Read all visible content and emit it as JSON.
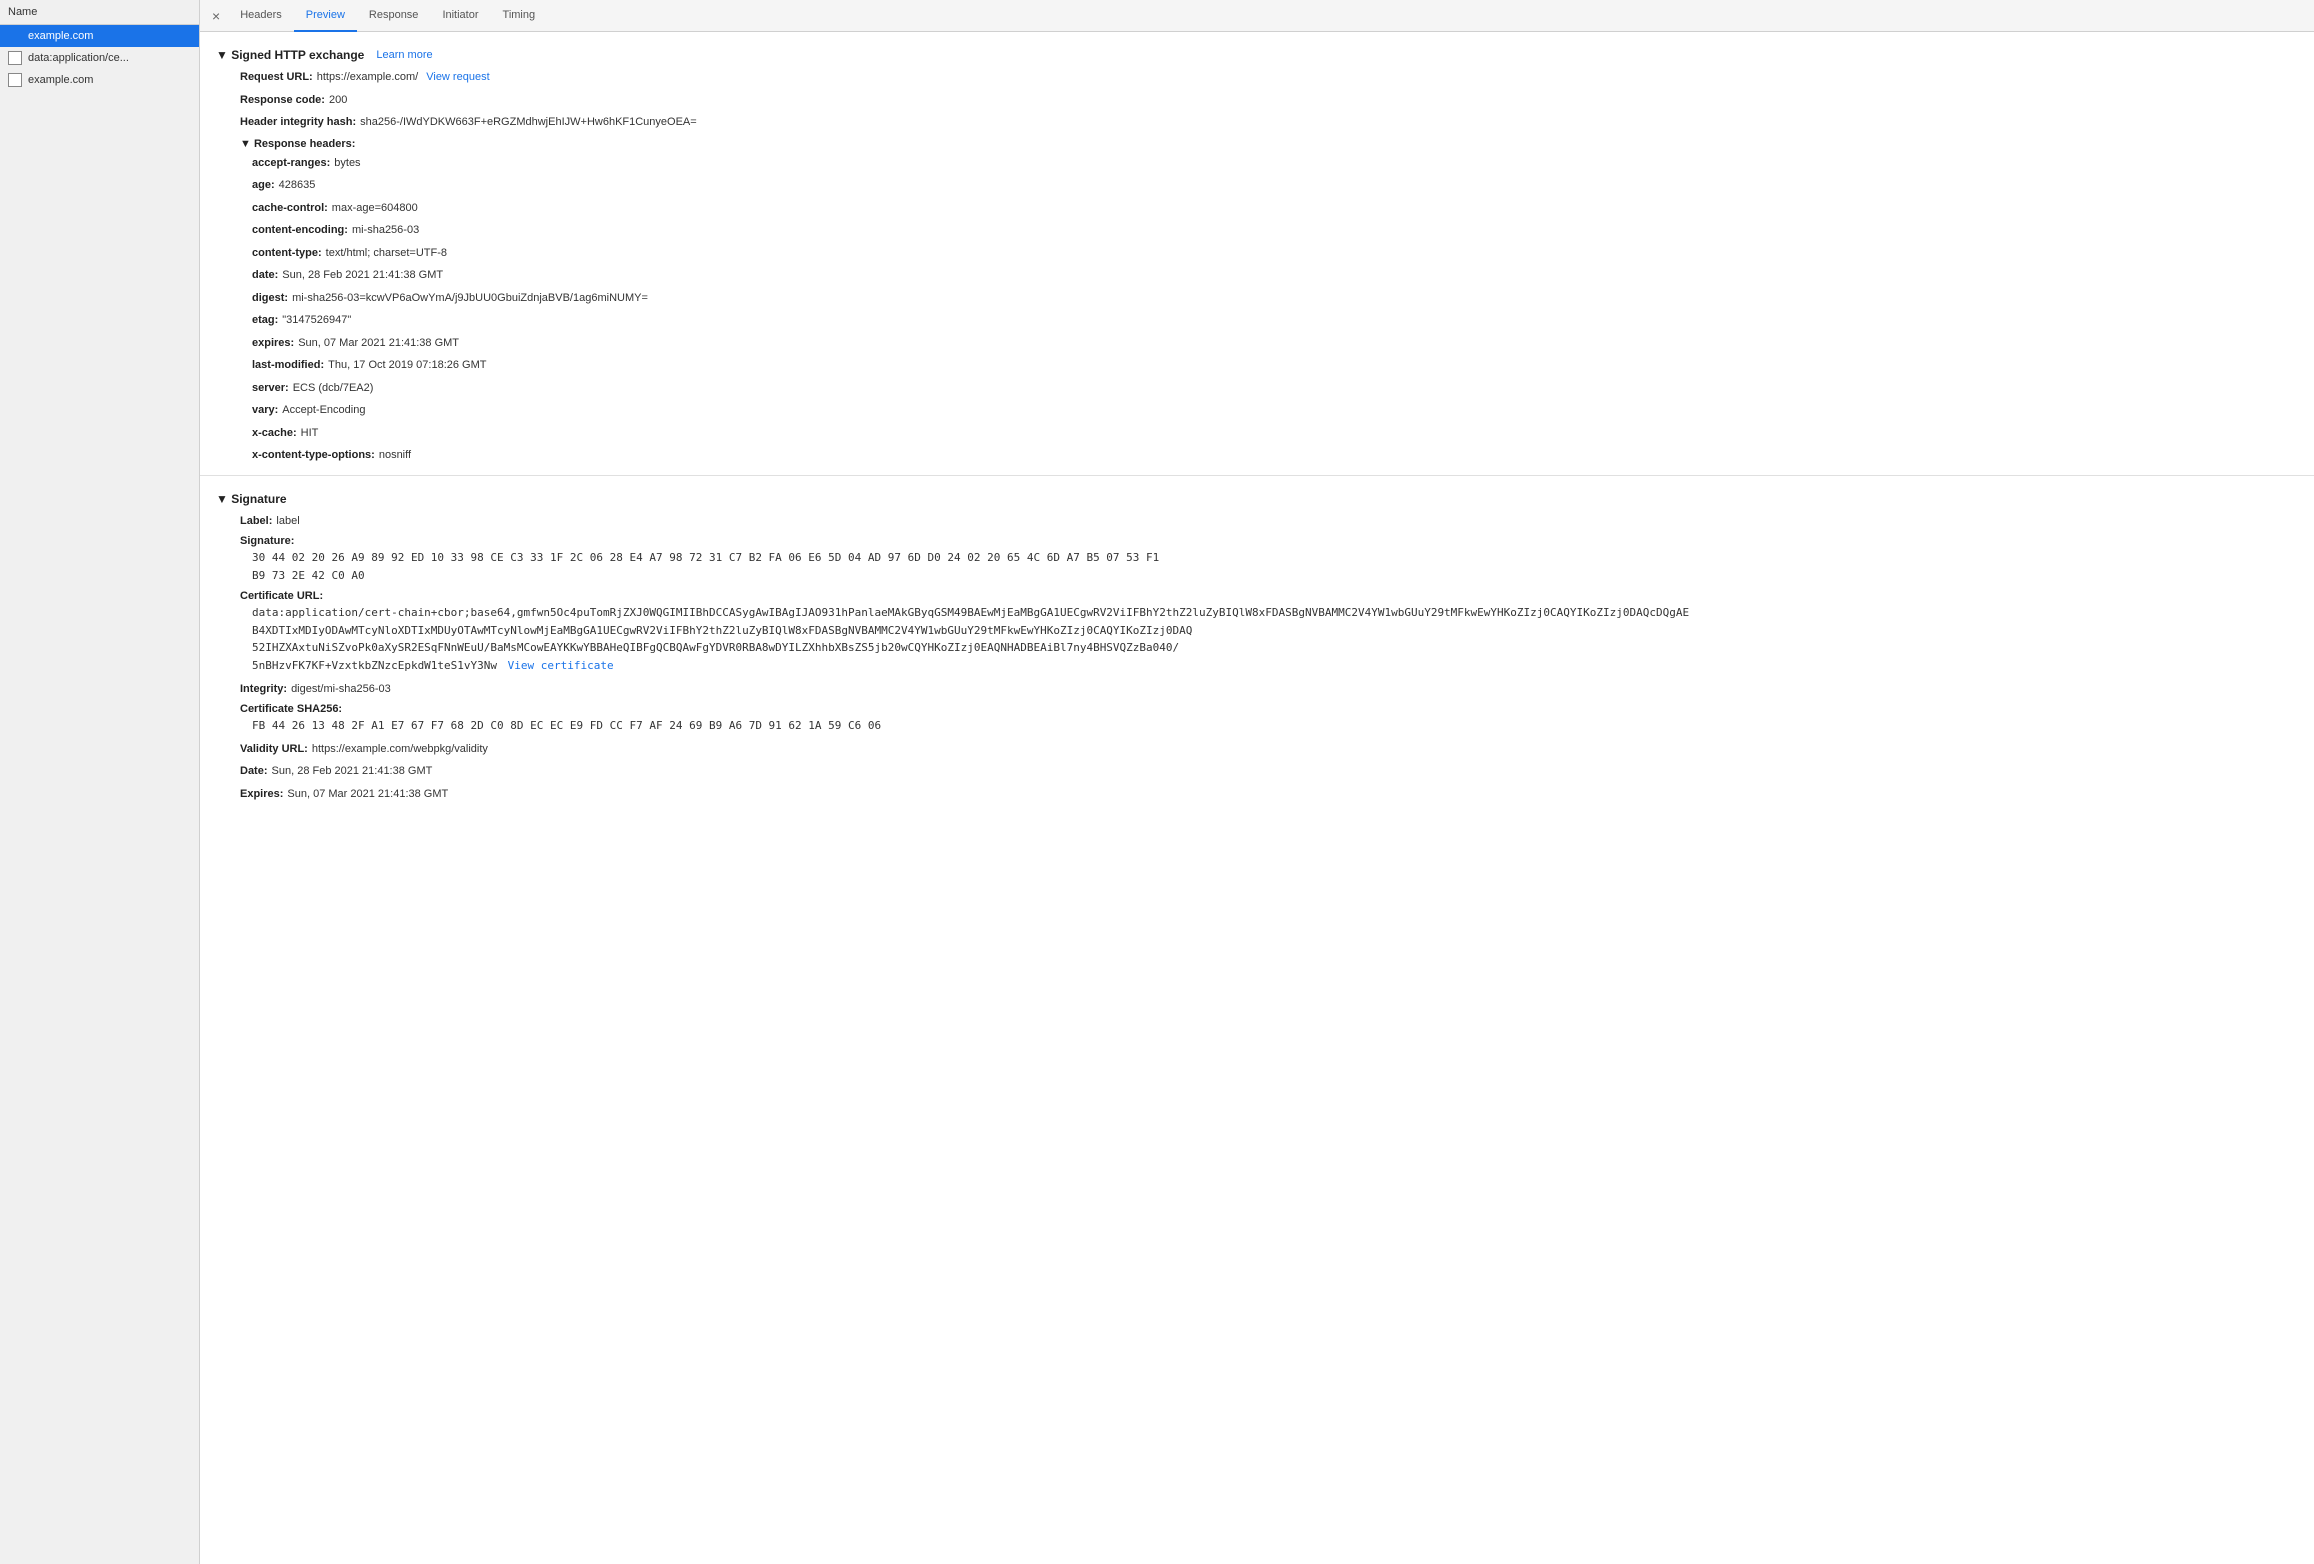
{
  "sidebar": {
    "header": "Name",
    "items": [
      {
        "id": "item-example-com",
        "label": "example.com",
        "active": true
      },
      {
        "id": "item-data-app",
        "label": "data:application/ce...",
        "active": false
      },
      {
        "id": "item-example-com-2",
        "label": "example.com",
        "active": false
      }
    ]
  },
  "tabs": {
    "close_label": "×",
    "items": [
      {
        "id": "tab-headers",
        "label": "Headers",
        "active": false
      },
      {
        "id": "tab-preview",
        "label": "Preview",
        "active": true
      },
      {
        "id": "tab-response",
        "label": "Response",
        "active": false
      },
      {
        "id": "tab-initiator",
        "label": "Initiator",
        "active": false
      },
      {
        "id": "tab-timing",
        "label": "Timing",
        "active": false
      }
    ]
  },
  "signed_http": {
    "section_title": "▼ Signed HTTP exchange",
    "learn_more": "Learn more",
    "request_url_label": "Request URL:",
    "request_url_value": "https://example.com/",
    "view_request": "View request",
    "response_code_label": "Response code:",
    "response_code_value": "200",
    "header_integrity_label": "Header integrity hash:",
    "header_integrity_value": "sha256-/IWdYDKW663F+eRGZMdhwjEhIJW+Hw6hKF1CunyeOEA=",
    "response_headers_title": "▼ Response headers:",
    "headers": [
      {
        "label": "accept-ranges:",
        "value": "bytes"
      },
      {
        "label": "age:",
        "value": "428635"
      },
      {
        "label": "cache-control:",
        "value": "max-age=604800"
      },
      {
        "label": "content-encoding:",
        "value": "mi-sha256-03"
      },
      {
        "label": "content-type:",
        "value": "text/html; charset=UTF-8"
      },
      {
        "label": "date:",
        "value": "Sun, 28 Feb 2021 21:41:38 GMT"
      },
      {
        "label": "digest:",
        "value": "mi-sha256-03=kcwVP6aOwYmA/j9JbUU0GbuiZdnjaBVB/1ag6miNUMY="
      },
      {
        "label": "etag:",
        "value": "\"3147526947\""
      },
      {
        "label": "expires:",
        "value": "Sun, 07 Mar 2021 21:41:38 GMT"
      },
      {
        "label": "last-modified:",
        "value": "Thu, 17 Oct 2019 07:18:26 GMT"
      },
      {
        "label": "server:",
        "value": "ECS (dcb/7EA2)"
      },
      {
        "label": "vary:",
        "value": "Accept-Encoding"
      },
      {
        "label": "x-cache:",
        "value": "HIT"
      },
      {
        "label": "x-content-type-options:",
        "value": "nosniff"
      }
    ]
  },
  "signature": {
    "section_title": "▼ Signature",
    "label_label": "Label:",
    "label_value": "label",
    "signature_label": "Signature:",
    "signature_line1": "30 44 02 20 26 A9 89 92 ED 10 33 98 CE C3 33 1F 2C 06 28 E4 A7 98 72 31 C7 B2 FA 06 E6 5D 04 AD 97 6D D0 24 02 20 65 4C 6D A7 B5 07 53 F1",
    "signature_line2": "B9 73 2E 42 C0 A0",
    "cert_url_label": "Certificate URL:",
    "cert_url_value": "data:application/cert-chain+cbor;base64,gmfwn5Oc4puTomRjZXJ0WQGIMIIBhDCCASygAwIBAgIJAO931hPanlaeMAkGByqGSM49BAEwMjEaMBgGA1UECgwRV2ViIFBhY2thZ2luZyBIQlW8xFDASBgNVBAMMC2V4YW1wbGUuY29tMFkwEwYHKoZIzj0CAQYIKoZIzj0DAQcDQgAE",
    "cert_url_line2": "B4XDTIxMDIyODAwMTcyNloXDTIxMDUyOTAwMTcyNlowMjEaMBgGA1UECgwRV2ViIFBhY2thZ2luZyBIQlW8xFDASBgNVBAMMC2V4YW1wbGUuY29tMFkwEwYHKoZIzj0CAQYIKoZIzj0DAQ",
    "cert_url_line3": "52IHZXAxtuNiSZvoPk0aXySR2ESqFNnWEuU/BaMsMCowEAYKKwYBBAHeQIBFgQCBQAwFgYDVR0RBA8wDYILZXhhbXBsZS5jb20wCQYHKoZIzj0EAQNHADBEAiBl7ny4BHSVQZzBa040/",
    "cert_url_line4": "5nBHzvFK7KF+VzxtkbZNzcEpkdW1teS1vY3Nw",
    "view_certificate": "View certificate",
    "integrity_label": "Integrity:",
    "integrity_value": "digest/mi-sha256-03",
    "cert_sha256_label": "Certificate SHA256:",
    "cert_sha256_value": "FB 44 26 13 48 2F A1 E7 67 F7 68 2D C0 8D EC EC E9 FD CC F7 AF 24 69 B9 A6 7D 91 62 1A 59 C6 06",
    "validity_url_label": "Validity URL:",
    "validity_url_value": "https://example.com/webpkg/validity",
    "date_label": "Date:",
    "date_value": "Sun, 28 Feb 2021 21:41:38 GMT",
    "expires_label": "Expires:",
    "expires_value": "Sun, 07 Mar 2021 21:41:38 GMT"
  }
}
